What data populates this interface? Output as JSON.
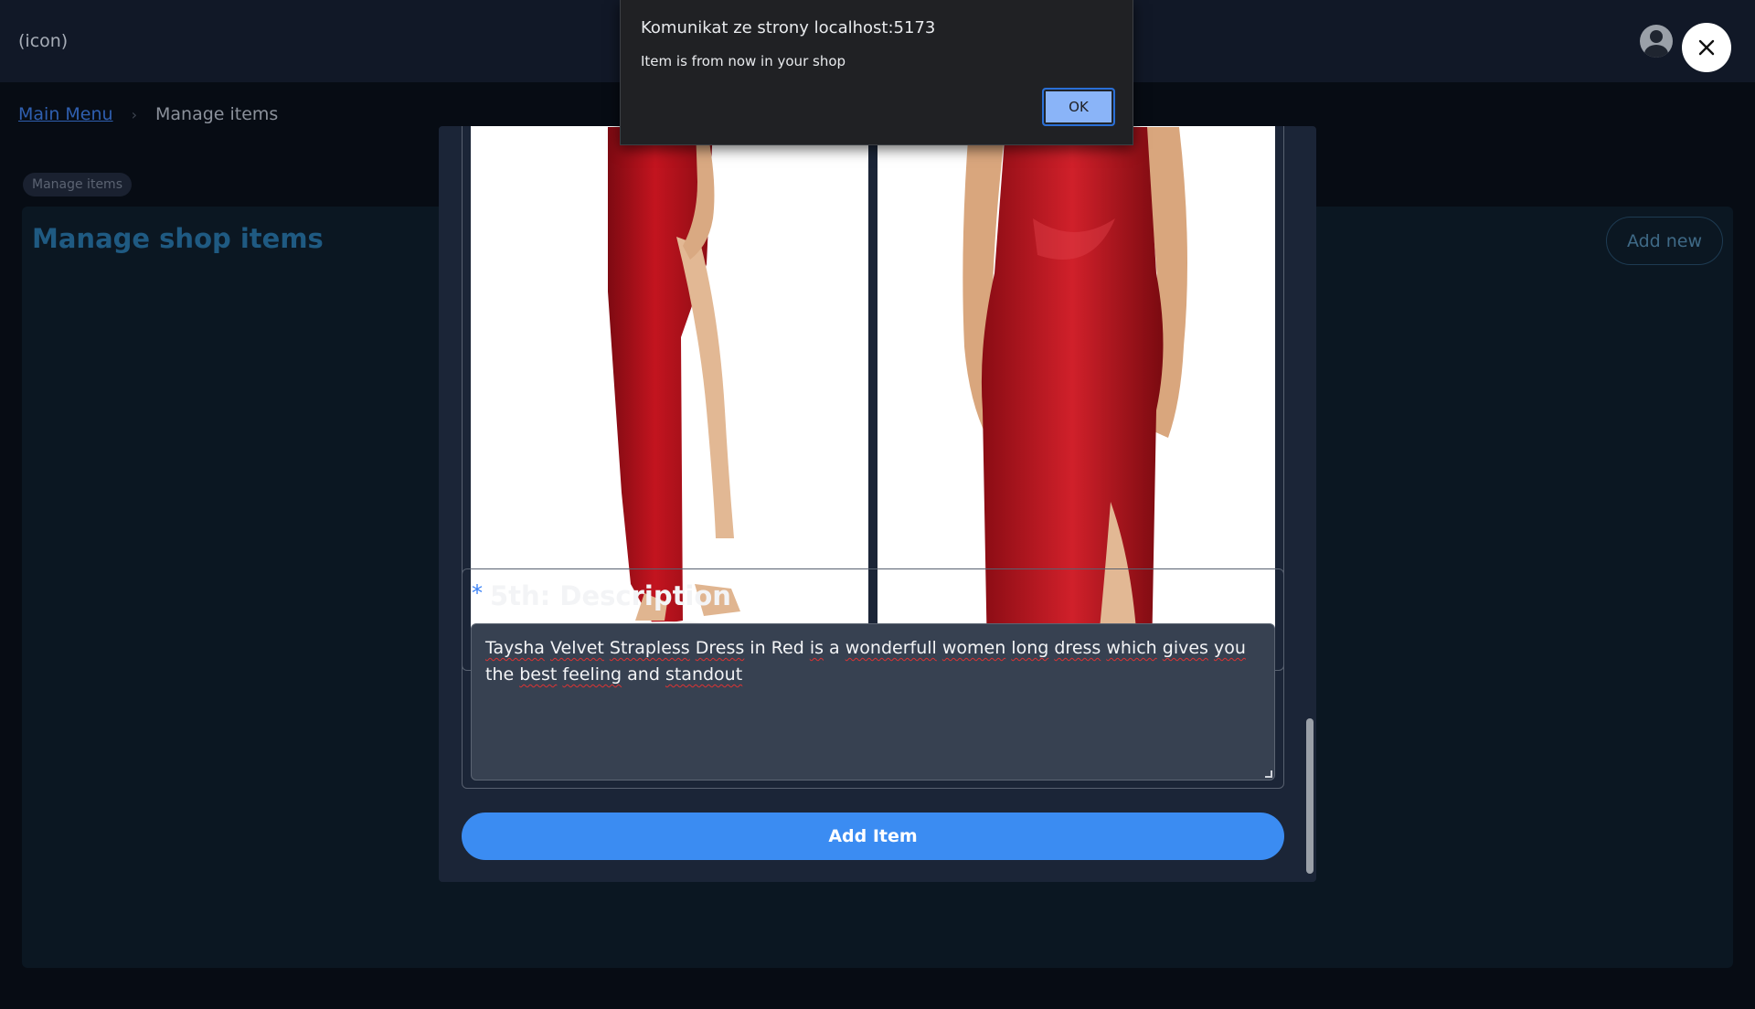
{
  "header": {
    "icon_text": "(icon)"
  },
  "breadcrumb": {
    "main_menu": "Main Menu",
    "separator": "›",
    "current": "Manage items"
  },
  "page": {
    "tag": "Manage items",
    "title": "Manage shop items",
    "add_new": "Add new"
  },
  "modal": {
    "description": {
      "required_mark": "*",
      "label": "5th: Description",
      "value_words": [
        {
          "w": "Taysha",
          "spell": true
        },
        {
          "w": " ",
          "spell": false
        },
        {
          "w": "Velvet",
          "spell": true
        },
        {
          "w": " ",
          "spell": false
        },
        {
          "w": "Strapless",
          "spell": true
        },
        {
          "w": " ",
          "spell": false
        },
        {
          "w": "Dress",
          "spell": true
        },
        {
          "w": " in Red ",
          "spell": false
        },
        {
          "w": "is",
          "spell": true
        },
        {
          "w": " a ",
          "spell": false
        },
        {
          "w": "wonderfull",
          "spell": true
        },
        {
          "w": " ",
          "spell": false
        },
        {
          "w": "women",
          "spell": true
        },
        {
          "w": " ",
          "spell": false
        },
        {
          "w": "long",
          "spell": true
        },
        {
          "w": " ",
          "spell": false
        },
        {
          "w": "dress",
          "spell": true
        },
        {
          "w": " ",
          "spell": false
        },
        {
          "w": "which",
          "spell": true
        },
        {
          "w": " ",
          "spell": false
        },
        {
          "w": "gives",
          "spell": true
        },
        {
          "w": " ",
          "spell": false
        },
        {
          "w": "you",
          "spell": true
        },
        {
          "w": " the ",
          "spell": false
        },
        {
          "w": "best",
          "spell": true
        },
        {
          "w": " ",
          "spell": false
        },
        {
          "w": "feeling",
          "spell": true
        },
        {
          "w": " and ",
          "spell": false
        },
        {
          "w": "standout",
          "spell": true
        }
      ]
    },
    "add_item": "Add Item"
  },
  "alert": {
    "title": "Komunikat ze strony localhost:5173",
    "message": "Item is from now in your shop",
    "ok": "OK"
  },
  "colors": {
    "accent": "#3b8cf2",
    "dress_red": "#b3121c",
    "modal_bg": "#1b2537"
  }
}
